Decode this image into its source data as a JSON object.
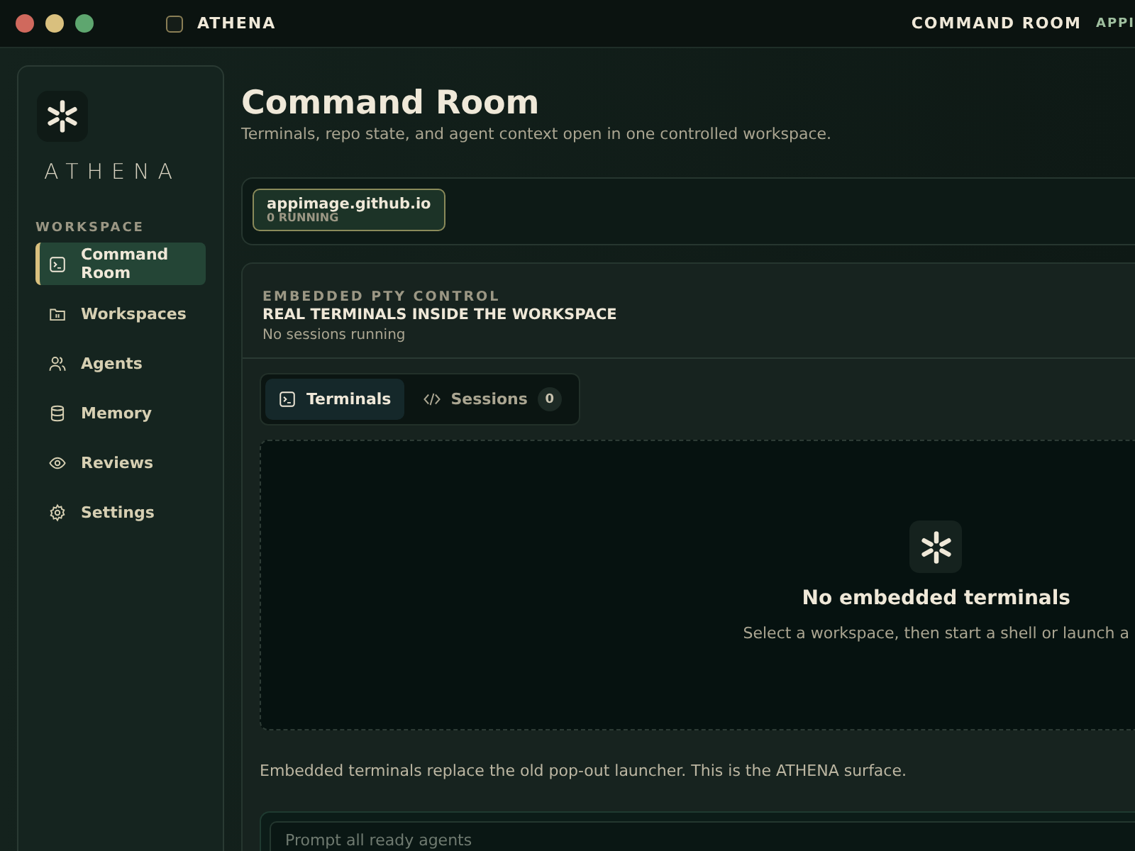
{
  "titlebar": {
    "app_name": "ATHENA",
    "page": "COMMAND ROOM",
    "workspace": "APPI"
  },
  "sidebar": {
    "brand": "ATHENA",
    "section": "WORKSPACE",
    "items": [
      {
        "label": "Command Room",
        "kind": "terminal",
        "selected": true
      },
      {
        "label": "Workspaces",
        "kind": "folder",
        "selected": false
      },
      {
        "label": "Agents",
        "kind": "users",
        "selected": false
      },
      {
        "label": "Memory",
        "kind": "database",
        "selected": false
      },
      {
        "label": "Reviews",
        "kind": "eye",
        "selected": false
      },
      {
        "label": "Settings",
        "kind": "gear",
        "selected": false
      }
    ]
  },
  "header": {
    "title": "Command Room",
    "subtitle": "Terminals, repo state, and agent context open in one controlled workspace."
  },
  "workspace_chips": [
    {
      "name": "appimage.github.io",
      "status": "0 RUNNING",
      "selected": true
    }
  ],
  "panel": {
    "eyebrow": "EMBEDDED PTY CONTROL",
    "title": "REAL TERMINALS INSIDE THE WORKSPACE",
    "status": "No sessions running",
    "tabs": [
      {
        "label": "Terminals",
        "kind": "terminal",
        "selected": true
      },
      {
        "label": "Sessions",
        "kind": "code",
        "count": "0",
        "selected": false
      }
    ],
    "empty_title": "No embedded terminals",
    "empty_text": "Select a workspace, then start a shell or launch a",
    "note": "Embedded terminals replace the old pop-out launcher. This is the ATHENA surface.",
    "prompt": {
      "placeholder": "Prompt all ready agents"
    }
  }
}
